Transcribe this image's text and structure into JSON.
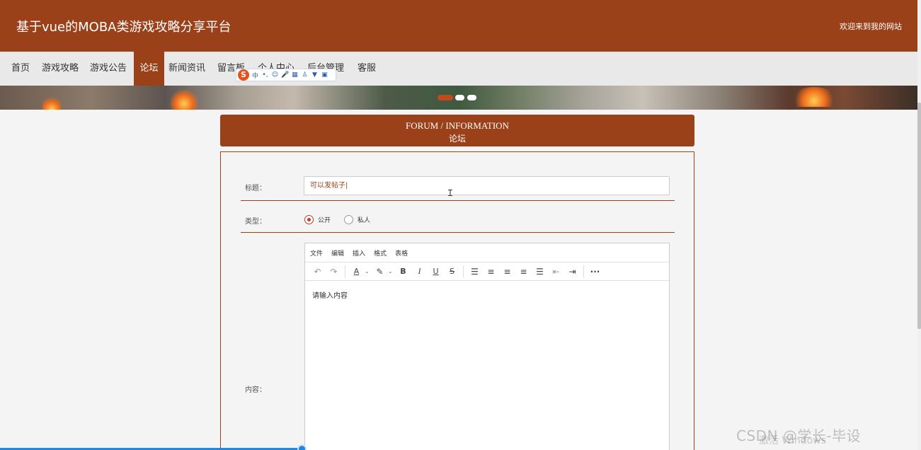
{
  "header": {
    "site_title": "基于vue的MOBA类游戏攻略分享平台",
    "welcome": "欢迎来到我的网站"
  },
  "nav": {
    "items": [
      {
        "label": "首页"
      },
      {
        "label": "游戏攻略"
      },
      {
        "label": "游戏公告"
      },
      {
        "label": "论坛",
        "active": true
      },
      {
        "label": "新闻资讯"
      },
      {
        "label": "留言板"
      },
      {
        "label": "个人中心"
      },
      {
        "label": "后台管理"
      },
      {
        "label": "客服"
      }
    ]
  },
  "ime": {
    "logo": "S",
    "mode": "中"
  },
  "forum": {
    "title_en": "FORUM / INFORMATION",
    "title_cn": "论坛"
  },
  "form": {
    "title_label": "标题：",
    "title_value": "可以发帖子|",
    "type_label": "类型：",
    "type_options": [
      {
        "label": "公开",
        "checked": true
      },
      {
        "label": "私人",
        "checked": false
      }
    ],
    "content_label": "内容："
  },
  "editor": {
    "menu": [
      "文件",
      "编辑",
      "插入",
      "格式",
      "表格"
    ],
    "placeholder": "请输入内容"
  },
  "watermark": {
    "text1": "CSDN @学长-毕设",
    "text2": "激活 Windows"
  },
  "colors": {
    "brand": "#9a4119",
    "nav_bg": "#e9e9e9",
    "radio_checked": "#c0392b"
  }
}
